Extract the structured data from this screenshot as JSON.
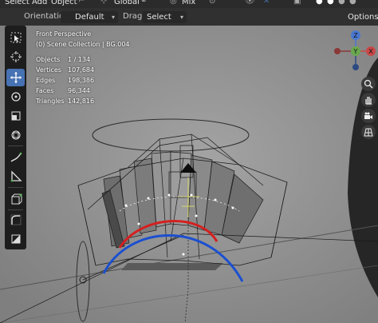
{
  "menubar": {
    "select": "Select",
    "add": "Add",
    "object": "Object",
    "transform_orientation": "Global",
    "pivot": "Mix"
  },
  "header": {
    "orientation_label": "Orientation:",
    "orientation_value": "Default",
    "drag_label": "Drag:",
    "drag_value": "Select Box",
    "options_label": "Options"
  },
  "overlay": {
    "view_name": "Front Perspective",
    "collection": "(0) Scene Collection | BG.004",
    "stats": [
      {
        "label": "Objects",
        "value": "1 / 134"
      },
      {
        "label": "Vertices",
        "value": "107,684"
      },
      {
        "label": "Edges",
        "value": "198,386"
      },
      {
        "label": "Faces",
        "value": "96,344"
      },
      {
        "label": "Triangles",
        "value": "142,816"
      }
    ]
  },
  "gizmo": {
    "z": "Z",
    "y": "Y",
    "x": "X"
  },
  "toolbar_tools": [
    "select-box",
    "cursor",
    "move",
    "rotate",
    "scale",
    "transform",
    "annotate",
    "measure",
    "add-cube",
    "spin",
    "shear"
  ],
  "colors": {
    "accent": "#4772b3",
    "viewport_bg": "#8e8e8e",
    "curve_red": "#d42020",
    "curve_blue": "#1b4fd0"
  }
}
